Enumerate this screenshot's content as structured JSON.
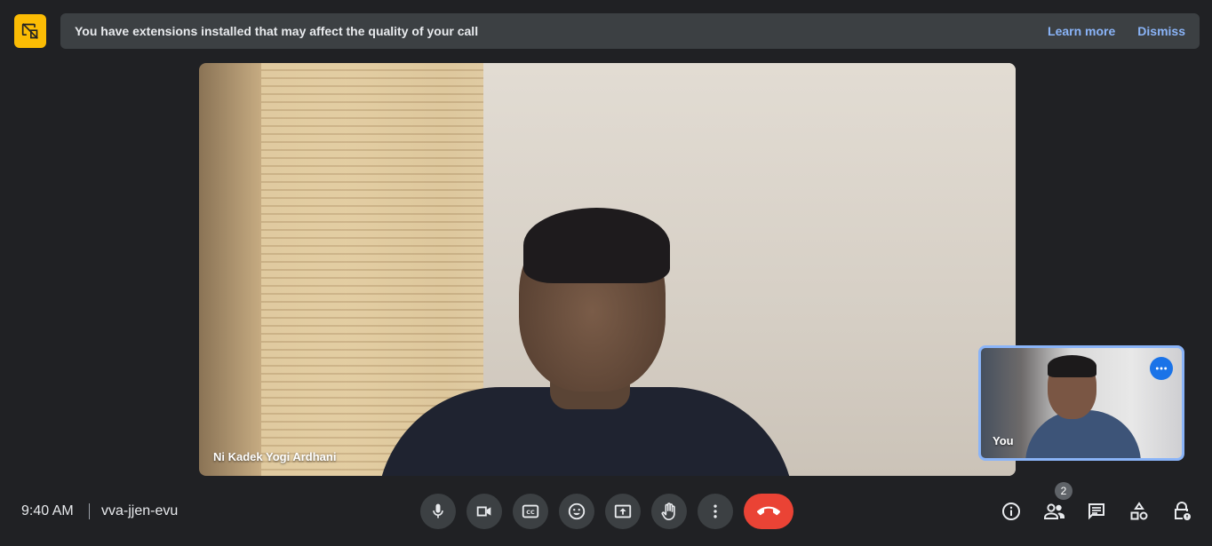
{
  "banner": {
    "message": "You have extensions installed that may affect the quality of your call",
    "learn_more": "Learn more",
    "dismiss": "Dismiss"
  },
  "main_tile": {
    "participant_name": "Ni Kadek Yogi Ardhani"
  },
  "self_tile": {
    "label": "You"
  },
  "meeting": {
    "time": "9:40 AM",
    "code": "vva-jjen-evu"
  },
  "controls": [
    {
      "name": "microphone",
      "icon": "mic-icon"
    },
    {
      "name": "camera",
      "icon": "videocam-icon"
    },
    {
      "name": "captions",
      "icon": "closed-caption-icon"
    },
    {
      "name": "reactions",
      "icon": "emoji-icon"
    },
    {
      "name": "present",
      "icon": "present-screen-icon"
    },
    {
      "name": "raise-hand",
      "icon": "hand-icon"
    },
    {
      "name": "more-options",
      "icon": "more-vert-icon"
    },
    {
      "name": "leave-call",
      "icon": "call-end-icon"
    }
  ],
  "side_controls": {
    "people_count": "2",
    "icons": [
      "info-icon",
      "people-icon",
      "chat-icon",
      "activities-icon",
      "host-controls-icon"
    ]
  },
  "colors": {
    "accent": "#8ab4f8",
    "end_call": "#ea4335",
    "warning": "#fbbc04",
    "background": "#202124"
  }
}
